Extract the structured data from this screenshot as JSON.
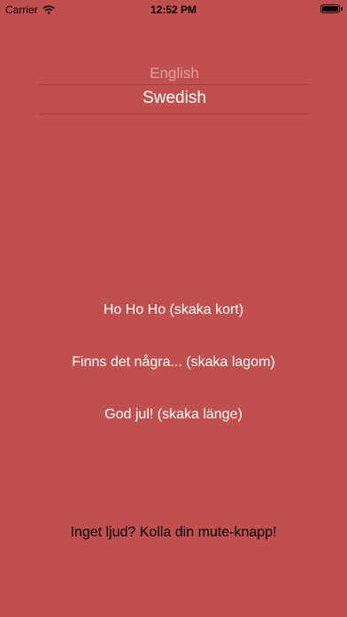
{
  "status_bar": {
    "carrier": "Carrier",
    "time": "12:52 PM",
    "icons": [
      "wifi-icon",
      "battery-icon"
    ]
  },
  "language_picker": {
    "options": [
      "English",
      "Swedish"
    ],
    "selected": "Swedish"
  },
  "sounds": [
    {
      "label": "Ho Ho Ho (skaka kort)"
    },
    {
      "label": "Finns det några... (skaka lagom)"
    },
    {
      "label": "God jul! (skaka länge)"
    }
  ],
  "mute_hint": "Inget ljud? Kolla din mute-knapp!",
  "colors": {
    "background": "#c0504d",
    "text": "#ffffff",
    "hint_text": "#000000"
  }
}
